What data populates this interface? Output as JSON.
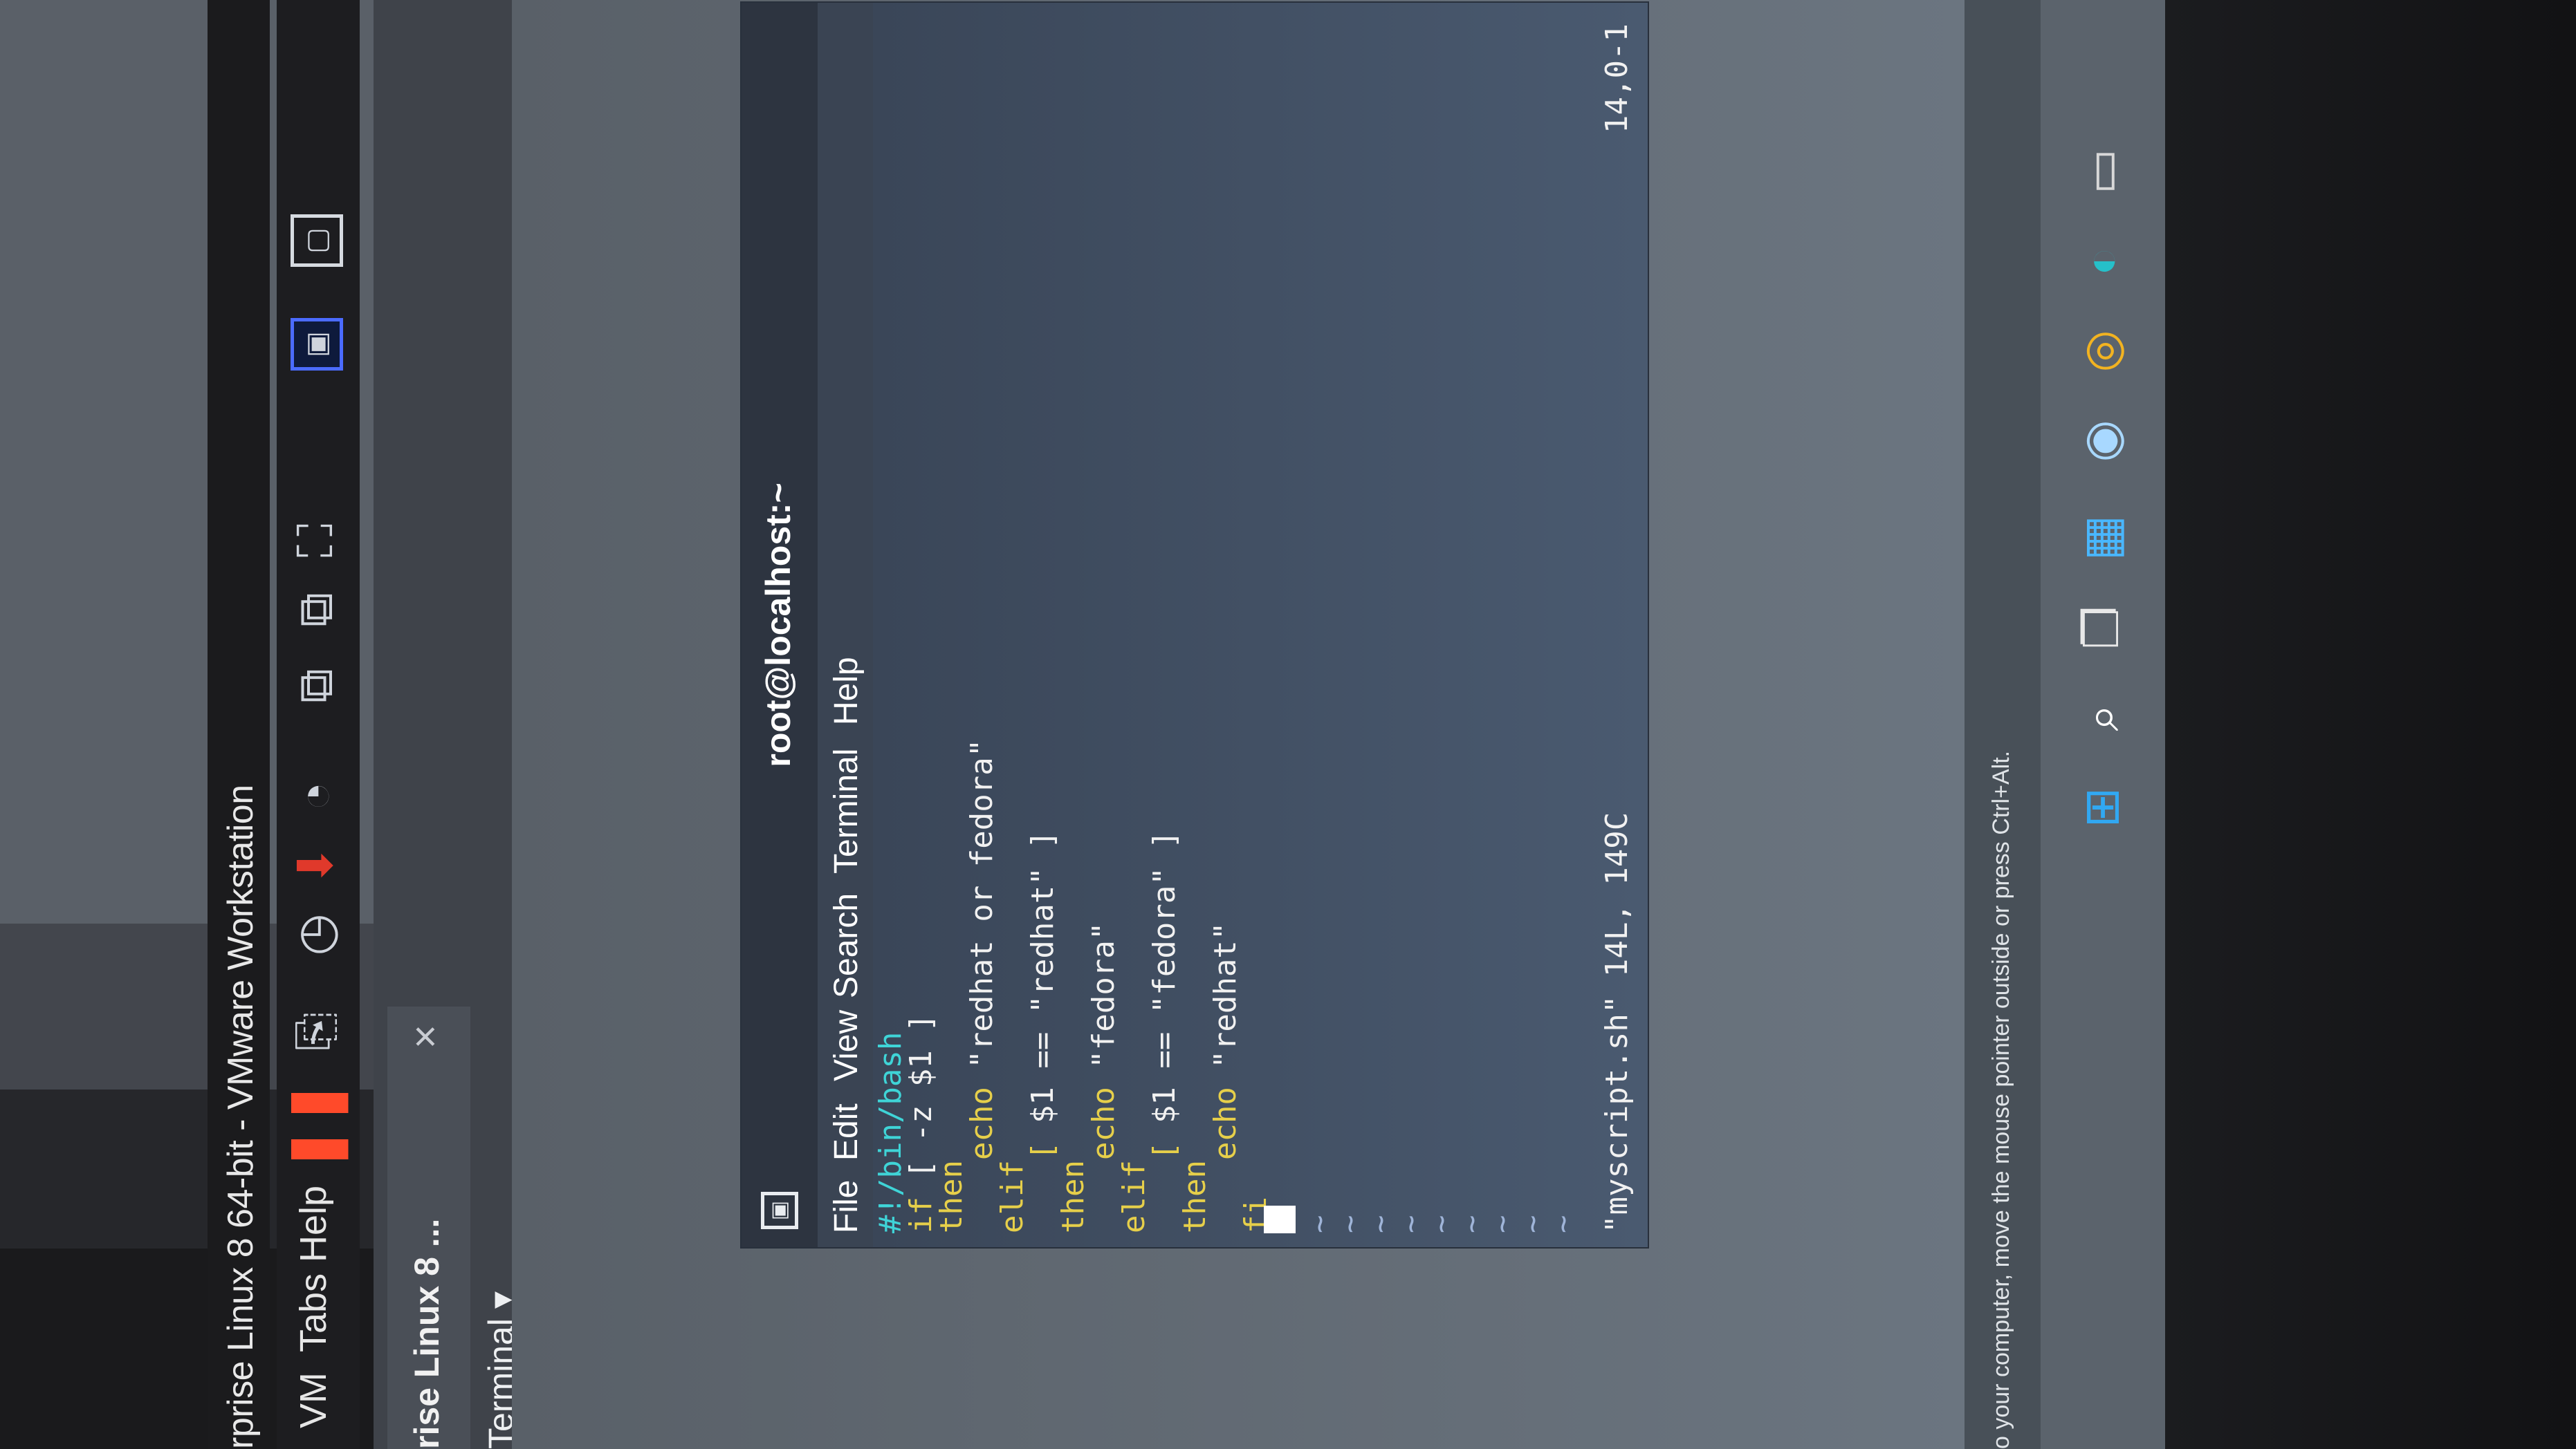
{
  "vmware": {
    "title": "rprise Linux 8 64-bit - VMware Workstation",
    "menus": [
      "VM",
      "Tabs",
      "Help"
    ],
    "tab_label": "rise Linux 8 ...",
    "tab_close": "×",
    "gnome_menu": "Terminal ▾"
  },
  "icons": {
    "pause": "❚❚",
    "send_keys": "⎘",
    "snapshot": "◷",
    "revert": "⬇",
    "manage_snapshots": "◔",
    "view_a": "▢",
    "view_b": "▢",
    "fullscreen": "⛶",
    "unity": "▣",
    "console": "⧉",
    "terminal_app": "▣"
  },
  "terminal": {
    "title": "root@localhost:~",
    "menus": [
      "File",
      "Edit",
      "View",
      "Search",
      "Terminal",
      "Help"
    ],
    "lines": [
      {
        "kw": "",
        "rest": "#!/bin/bash",
        "cls": "c-shebang"
      },
      {
        "kw": "if",
        "rest": " [ -z $1 ]"
      },
      {
        "kw": "then",
        "rest": ""
      },
      {
        "kw": "    echo",
        "rest": " \"redhat or fedora\""
      },
      {
        "kw": "elif",
        "rest": ""
      },
      {
        "kw": "    [",
        "rest": " $1 == \"redhat\" ]"
      },
      {
        "kw": "then",
        "rest": ""
      },
      {
        "kw": "    echo",
        "rest": " \"fedora\""
      },
      {
        "kw": "elif",
        "rest": ""
      },
      {
        "kw": "    [",
        "rest": " $1 == \"fedora\" ]"
      },
      {
        "kw": "then",
        "rest": ""
      },
      {
        "kw": "    echo",
        "rest": " \"redhat\""
      },
      {
        "kw": "fi",
        "rest": ""
      }
    ],
    "tilde": "~",
    "status_file": "\"myscript.sh\" 14L, 149C",
    "status_pos": "14,0-1"
  },
  "host": {
    "notice": "o your computer, move the mouse pointer outside or press Ctrl+Alt.",
    "taskbar_icons": [
      "windows-start",
      "search",
      "task-view",
      "widgets",
      "chat",
      "chrome",
      "edge",
      "store"
    ]
  }
}
